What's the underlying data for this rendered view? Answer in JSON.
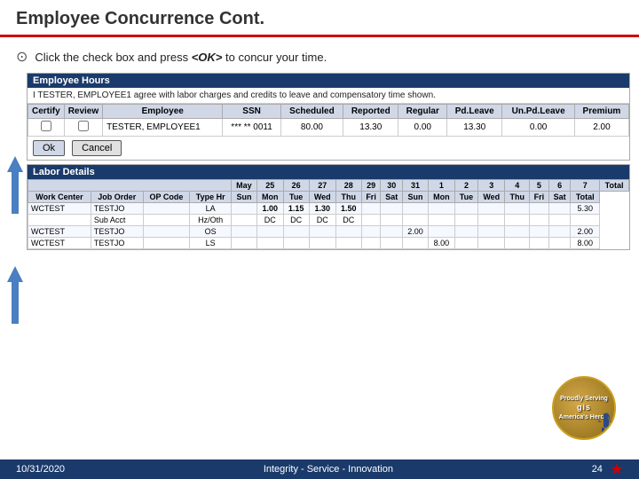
{
  "header": {
    "title": "Employee Concurrence Cont.",
    "border_color": "#cc0000"
  },
  "instruction": {
    "text": "Click the check box and press <OK> to concur your time.",
    "bullet": "⊙"
  },
  "employee_hours": {
    "section_title": "Employee Hours",
    "agree_text": "I TESTER, EMPLOYEE1 agree with labor charges and credits to leave and compensatory time shown.",
    "table_headers": [
      "Certify",
      "Review",
      "Employee",
      "SSN",
      "Scheduled",
      "Reported",
      "Regular",
      "Pd.Leave",
      "Un.Pd.Leave",
      "Premium"
    ],
    "row": {
      "certify": "",
      "review": "",
      "employee": "TESTER, EMPLOYEE1",
      "ssn": "*** ** 0011",
      "scheduled": "80.00",
      "reported": "13.30",
      "regular": "0.00",
      "pd_leave": "13.30",
      "unpd_leave": "0.00",
      "premium": "2.00"
    },
    "ok_label": "Ok",
    "cancel_label": "Cancel"
  },
  "labor_details": {
    "section_title": "Labor Details",
    "date_headers": [
      "May",
      "25",
      "26",
      "27",
      "28",
      "29",
      "30",
      "31",
      "1",
      "2",
      "3",
      "4",
      "5",
      "6",
      "7"
    ],
    "col_headers": [
      "Work Center",
      "Job Order",
      "OP Code",
      "Type Hr",
      "Sun",
      "Mon",
      "Tue",
      "Wed",
      "Thu",
      "Fri",
      "Sat",
      "Sun",
      "Mon",
      "Tue",
      "Wed",
      "Thu",
      "Fri",
      "Sat",
      "Total"
    ],
    "rows": [
      {
        "work_center": "WCTEST",
        "job_order": "TESTJO",
        "op_code": "",
        "type_hr": "LA",
        "sun": "",
        "mon": "1.00",
        "tue": "1.15",
        "wed": "1.30",
        "thu": "1.50",
        "fri": "",
        "sat": "",
        "sun2": "",
        "mon2": "",
        "tue2": "",
        "wed2": "",
        "thu2": "",
        "fri2": "",
        "sat2": "",
        "total": ""
      },
      {
        "work_center": "",
        "job_order": "Sub Acct",
        "op_code": "",
        "type_hr": "Hz/Oth",
        "sun": "",
        "mon": "DC",
        "tue": "DC",
        "wed": "DC",
        "thu": "DC",
        "fri": "",
        "sat": "",
        "sun2": "",
        "mon2": "",
        "tue2": "",
        "wed2": "",
        "thu2": "",
        "fri2": "",
        "sat2": "",
        "total": ""
      },
      {
        "work_center": "WCTEST",
        "job_order": "TESTJO",
        "op_code": "",
        "type_hr": "OS",
        "sun": "",
        "mon": "",
        "tue": "",
        "wed": "",
        "thu": "",
        "fri": "",
        "sat": "",
        "sun2": "2.00",
        "mon2": "",
        "tue2": "",
        "wed2": "",
        "thu2": "",
        "fri2": "",
        "sat2": "",
        "total": "2.00"
      },
      {
        "work_center": "WCTEST",
        "job_order": "TESTJO",
        "op_code": "",
        "type_hr": "LS",
        "sun": "",
        "mon": "",
        "tue": "",
        "wed": "",
        "thu": "",
        "fri": "",
        "sat": "",
        "sun2": "",
        "mon2": "8.00",
        "tue2": "",
        "wed2": "",
        "thu2": "",
        "fri2": "",
        "sat2": "",
        "total": "8.00"
      }
    ],
    "summary_total": "5.30"
  },
  "footer": {
    "date": "10/31/2020",
    "center_text": "Integrity - Service - Innovation",
    "page_number": "24"
  }
}
